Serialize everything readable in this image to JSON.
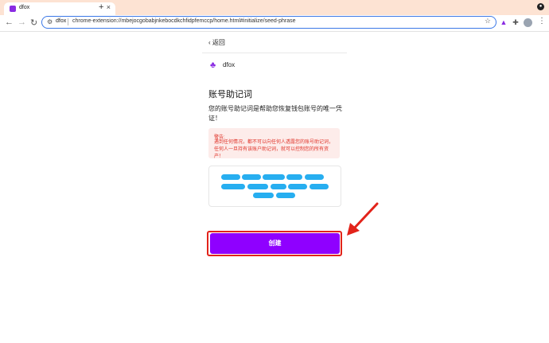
{
  "browser": {
    "tab_title": "dfox",
    "tab_close": "×",
    "new_tab": "+",
    "omnibox_ext_name": "dfox",
    "url": "chrome-extension://mbejocgobabjnkebocdkchfidpfemccp/home.html#initialize/seed-phrase",
    "star": "☆"
  },
  "page": {
    "back_label": "返回",
    "brand": "dfox",
    "title": "账号助记词",
    "description": "您的账号助记词是帮助您恢复钱包账号的唯一凭证！",
    "warning_title": "警告:",
    "warning_text": "遇到任何情况，都不可以向任何人透露您的账号助记词，任何人一旦持有该账户助记词，就可以控制您的所有资产！",
    "create_button": "创建"
  },
  "colors": {
    "accent": "#8f00ff",
    "warning": "#e0352b",
    "phrase_blur": "#27aef0",
    "highlight": "#e2231a"
  }
}
